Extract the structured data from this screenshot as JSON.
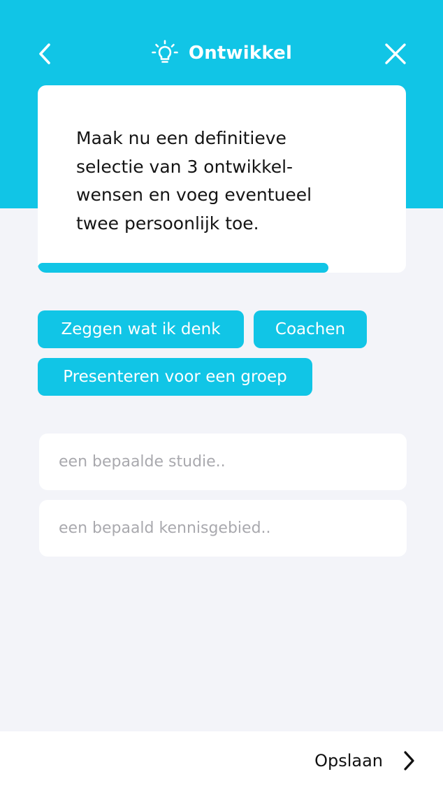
{
  "header": {
    "title": "Ontwikkel",
    "title_icon": "lightbulb-icon",
    "back_icon": "chevron-left-icon",
    "close_icon": "close-icon",
    "accent_color": "#11c5e6"
  },
  "instruction_card": {
    "lines": [
      "Maak nu een definitieve",
      "selectie van 3 ontwikkel-",
      "wensen en voeg eventueel",
      "twee persoonlijk toe."
    ],
    "progress_fraction": 0.79
  },
  "selected_chips": [
    {
      "label": "Zeggen wat ik denk"
    },
    {
      "label": "Coachen"
    },
    {
      "label": "Presenteren voor een groep"
    }
  ],
  "personal_inputs": [
    {
      "value": "",
      "placeholder": "een bepaalde studie.."
    },
    {
      "value": "",
      "placeholder": "een bepaald kennisgebied.."
    }
  ],
  "footer": {
    "save_label": "Opslaan",
    "save_icon": "chevron-right-icon"
  }
}
